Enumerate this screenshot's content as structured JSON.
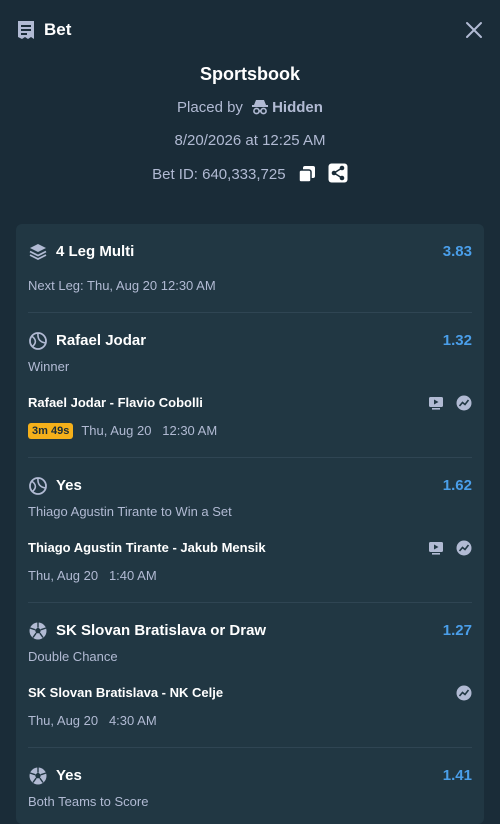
{
  "header": {
    "title": "Bet"
  },
  "summary": {
    "heading": "Sportsbook",
    "placed_by_label": "Placed by",
    "placed_by_user": "Hidden",
    "date": "8/20/2026 at 12:25 AM",
    "bet_id": "Bet ID: 640,333,725"
  },
  "multi": {
    "title": "4 Leg Multi",
    "odds": "3.83",
    "next_leg": "Next Leg: Thu, Aug 20 12:30 AM"
  },
  "legs": [
    {
      "selection": "Rafael Jodar",
      "odds": "1.32",
      "market": "Winner",
      "match": "Rafael Jodar - Flavio Cobolli",
      "countdown": "3m 49s",
      "time": "Thu, Aug 20   12:30 AM",
      "sport_icon": "tennis-ball-icon"
    },
    {
      "selection": "Yes",
      "odds": "1.62",
      "market": "Thiago Agustin Tirante to Win a Set",
      "match": "Thiago Agustin Tirante - Jakub Mensik",
      "time": "Thu, Aug 20   1:40 AM",
      "sport_icon": "tennis-ball-icon"
    },
    {
      "selection": "SK Slovan Bratislava or Draw",
      "odds": "1.27",
      "market": "Double Chance",
      "match": "SK Slovan Bratislava - NK Celje",
      "time": "Thu, Aug 20   4:30 AM",
      "sport_icon": "soccer-ball-icon"
    },
    {
      "selection": "Yes",
      "odds": "1.41",
      "market": "Both Teams to Score",
      "sport_icon": "soccer-ball-icon"
    }
  ],
  "colors": {
    "background": "#1a2c38",
    "card": "#213743",
    "odds": "#4a9ee9",
    "muted": "#b1bad3",
    "badge": "#f5b01a"
  }
}
